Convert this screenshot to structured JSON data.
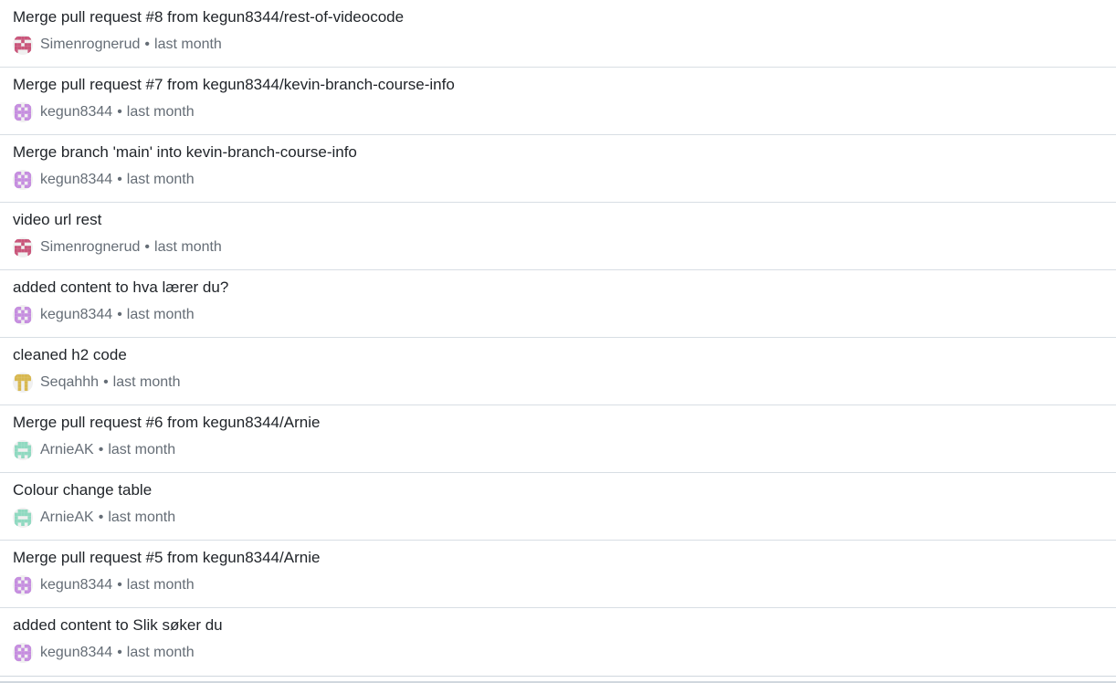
{
  "commits": [
    {
      "message": "Merge pull request #8 from kegun8344/rest-of-videocode",
      "author": "Simenrognerud",
      "time": "last month",
      "avatar": "simen"
    },
    {
      "message": "Merge pull request #7 from kegun8344/kevin-branch-course-info",
      "author": "kegun8344",
      "time": "last month",
      "avatar": "kegun"
    },
    {
      "message": "Merge branch 'main' into kevin-branch-course-info",
      "author": "kegun8344",
      "time": "last month",
      "avatar": "kegun"
    },
    {
      "message": "video url rest",
      "author": "Simenrognerud",
      "time": "last month",
      "avatar": "simen"
    },
    {
      "message": "added content to hva lærer du?",
      "author": "kegun8344",
      "time": "last month",
      "avatar": "kegun"
    },
    {
      "message": "cleaned h2 code",
      "author": "Seqahhh",
      "time": "last month",
      "avatar": "seqahhh"
    },
    {
      "message": "Merge pull request #6 from kegun8344/Arnie",
      "author": "ArnieAK",
      "time": "last month",
      "avatar": "arnie"
    },
    {
      "message": "Colour change table",
      "author": "ArnieAK",
      "time": "last month",
      "avatar": "arnie"
    },
    {
      "message": "Merge pull request #5 from kegun8344/Arnie",
      "author": "kegun8344",
      "time": "last month",
      "avatar": "kegun"
    },
    {
      "message": "added content to Slik søker du",
      "author": "kegun8344",
      "time": "last month",
      "avatar": "kegun"
    }
  ],
  "separator": "•",
  "avatar_colors": {
    "simen": "#c9557a",
    "kegun": "#c58ddf",
    "seqahhh": "#d8b84f",
    "arnie": "#8fd9c0"
  }
}
